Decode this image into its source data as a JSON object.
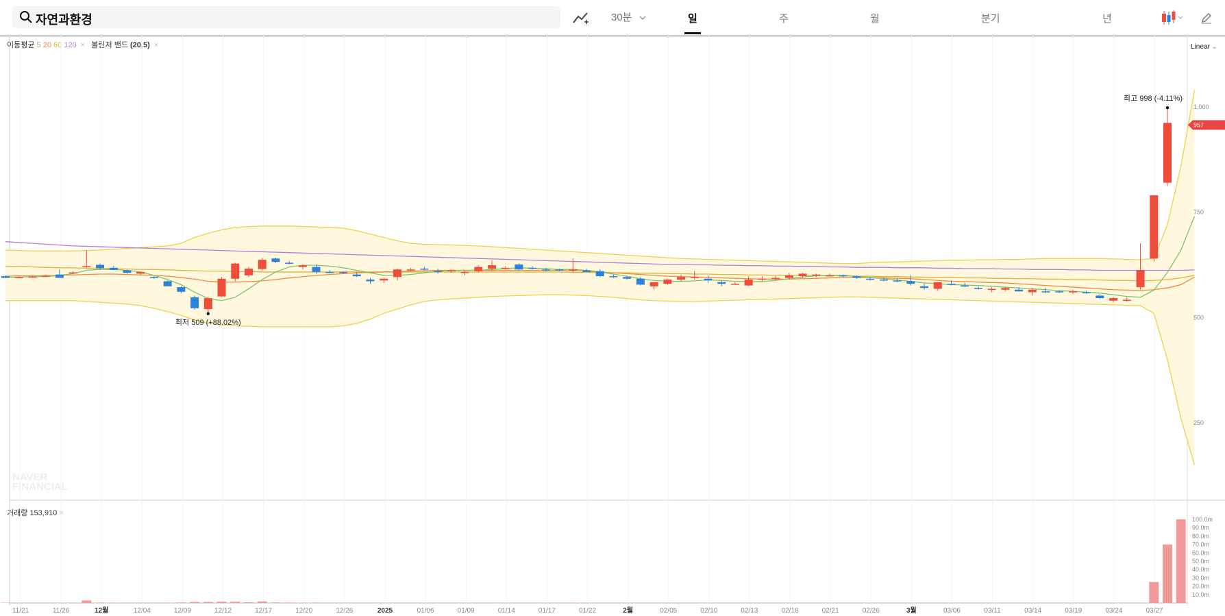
{
  "search": {
    "title": "자연과환경"
  },
  "toolbar": {
    "interval": "30분",
    "tabs": [
      "일",
      "주",
      "월",
      "분기",
      "년"
    ],
    "active_tab": "일"
  },
  "legend": {
    "ma_label": "이동평균",
    "ma_periods": [
      "5",
      "20",
      "60",
      "120"
    ],
    "bb_label": "볼린저 밴드",
    "bb_params": "(20,5)",
    "close_symbol": "×"
  },
  "scale_label": "Linear",
  "volume_label": "거래량",
  "volume_value": "153,910",
  "watermark": [
    "NAVER",
    "FINANCIAL"
  ],
  "colors": {
    "up": "#ee4d3a",
    "down": "#2b82d9",
    "ma5": "#7cc36b",
    "ma20": "#f08a3a",
    "ma60": "#e2b23a",
    "ma120": "#b47fd6",
    "band": "#f0d04e",
    "band_fill": "#fff8de",
    "volume": "#f29a9a"
  },
  "chart_data": {
    "type": "candlestick",
    "price_axis": {
      "ticks": [
        "1,000",
        "750",
        "500",
        "250"
      ],
      "values": [
        1000,
        750,
        500,
        250
      ],
      "current": "957"
    },
    "volume_axis": {
      "ticks": [
        "100.0m",
        "90.0m",
        "80.0m",
        "70.0m",
        "60.0m",
        "50.0m",
        "40.0m",
        "30.0m",
        "20.0m",
        "10.0m"
      ]
    },
    "x_labels": [
      {
        "text": "11/21",
        "bold": false
      },
      {
        "text": "11/26",
        "bold": false
      },
      {
        "text": "12월",
        "bold": true
      },
      {
        "text": "12/04",
        "bold": false
      },
      {
        "text": "12/09",
        "bold": false
      },
      {
        "text": "12/12",
        "bold": false
      },
      {
        "text": "12/17",
        "bold": false
      },
      {
        "text": "12/20",
        "bold": false
      },
      {
        "text": "12/26",
        "bold": false
      },
      {
        "text": "2025",
        "bold": true
      },
      {
        "text": "01/06",
        "bold": false
      },
      {
        "text": "01/09",
        "bold": false
      },
      {
        "text": "01/14",
        "bold": false
      },
      {
        "text": "01/17",
        "bold": false
      },
      {
        "text": "01/22",
        "bold": false
      },
      {
        "text": "2월",
        "bold": true
      },
      {
        "text": "02/05",
        "bold": false
      },
      {
        "text": "02/10",
        "bold": false
      },
      {
        "text": "02/13",
        "bold": false
      },
      {
        "text": "02/18",
        "bold": false
      },
      {
        "text": "02/21",
        "bold": false
      },
      {
        "text": "02/26",
        "bold": false
      },
      {
        "text": "3월",
        "bold": true
      },
      {
        "text": "03/06",
        "bold": false
      },
      {
        "text": "03/11",
        "bold": false
      },
      {
        "text": "03/14",
        "bold": false
      },
      {
        "text": "03/19",
        "bold": false
      },
      {
        "text": "03/24",
        "bold": false
      },
      {
        "text": "03/27",
        "bold": false
      }
    ],
    "annotations": {
      "high": "최고 998 (-4.11%)",
      "low": "최저 509 (+88.02%)"
    },
    "candles": [
      [
        598,
        600,
        595,
        594
      ],
      [
        596,
        598,
        594,
        596
      ],
      [
        596,
        599,
        594,
        597
      ],
      [
        598,
        601,
        597,
        599
      ],
      [
        602,
        614,
        598,
        594
      ],
      [
        605,
        610,
        604,
        607
      ],
      [
        620,
        660,
        618,
        622
      ],
      [
        625,
        628,
        614,
        617
      ],
      [
        618,
        623,
        612,
        613
      ],
      [
        612,
        614,
        604,
        606
      ],
      [
        604,
        608,
        600,
        608
      ],
      [
        596,
        598,
        592,
        594
      ],
      [
        586,
        588,
        576,
        574
      ],
      [
        572,
        575,
        558,
        561
      ],
      [
        548,
        552,
        519,
        522
      ],
      [
        520,
        549,
        509,
        546
      ],
      [
        550,
        596,
        548,
        592
      ],
      [
        592,
        630,
        586,
        628
      ],
      [
        600,
        620,
        596,
        616
      ],
      [
        615,
        642,
        612,
        637
      ],
      [
        640,
        642,
        630,
        632
      ],
      [
        630,
        634,
        626,
        628
      ],
      [
        620,
        626,
        614,
        624
      ],
      [
        620,
        626,
        604,
        608
      ],
      [
        608,
        612,
        605,
        606
      ],
      [
        608,
        610,
        604,
        606
      ],
      [
        602,
        608,
        596,
        598
      ],
      [
        590,
        594,
        580,
        586
      ],
      [
        588,
        594,
        582,
        592
      ],
      [
        596,
        616,
        588,
        614
      ],
      [
        614,
        618,
        610,
        614
      ],
      [
        616,
        620,
        612,
        614
      ],
      [
        610,
        616,
        604,
        608
      ],
      [
        610,
        614,
        606,
        612
      ],
      [
        606,
        612,
        600,
        608
      ],
      [
        610,
        624,
        606,
        620
      ],
      [
        616,
        636,
        612,
        624
      ],
      [
        618,
        622,
        614,
        618
      ],
      [
        626,
        628,
        612,
        614
      ],
      [
        618,
        622,
        614,
        616
      ],
      [
        614,
        618,
        610,
        612
      ],
      [
        614,
        616,
        610,
        612
      ],
      [
        612,
        640,
        608,
        614
      ],
      [
        612,
        616,
        608,
        608
      ],
      [
        610,
        614,
        596,
        598
      ],
      [
        598,
        602,
        594,
        596
      ],
      [
        596,
        598,
        590,
        592
      ],
      [
        592,
        596,
        576,
        578
      ],
      [
        574,
        582,
        566,
        584
      ],
      [
        580,
        592,
        578,
        590
      ],
      [
        590,
        602,
        586,
        596
      ],
      [
        594,
        610,
        590,
        596
      ],
      [
        592,
        600,
        582,
        588
      ],
      [
        584,
        588,
        574,
        580
      ],
      [
        580,
        584,
        578,
        580
      ],
      [
        576,
        598,
        574,
        590
      ],
      [
        590,
        598,
        586,
        592
      ],
      [
        592,
        598,
        588,
        594
      ],
      [
        594,
        606,
        590,
        600
      ],
      [
        598,
        606,
        594,
        604
      ],
      [
        600,
        604,
        596,
        602
      ],
      [
        600,
        604,
        598,
        600
      ],
      [
        600,
        602,
        596,
        598
      ],
      [
        598,
        600,
        592,
        594
      ],
      [
        592,
        596,
        588,
        590
      ],
      [
        590,
        594,
        586,
        588
      ],
      [
        588,
        592,
        584,
        586
      ],
      [
        586,
        600,
        576,
        580
      ],
      [
        574,
        580,
        566,
        570
      ],
      [
        568,
        584,
        564,
        584
      ],
      [
        580,
        588,
        576,
        578
      ],
      [
        576,
        582,
        572,
        574
      ],
      [
        570,
        574,
        566,
        568
      ],
      [
        566,
        572,
        560,
        568
      ],
      [
        566,
        572,
        562,
        570
      ],
      [
        566,
        572,
        562,
        562
      ],
      [
        560,
        570,
        552,
        566
      ],
      [
        562,
        570,
        558,
        560
      ],
      [
        562,
        564,
        558,
        560
      ],
      [
        560,
        566,
        556,
        562
      ],
      [
        560,
        564,
        556,
        558
      ],
      [
        552,
        556,
        544,
        546
      ],
      [
        540,
        548,
        536,
        546
      ],
      [
        542,
        548,
        538,
        542
      ],
      [
        572,
        676,
        566,
        612
      ],
      [
        640,
        790,
        632,
        790
      ],
      [
        820,
        998,
        812,
        962
      ]
    ],
    "ma5": [
      595,
      596,
      597,
      597,
      600,
      604,
      612,
      614,
      614,
      612,
      608,
      600,
      590,
      578,
      560,
      545,
      540,
      548,
      568,
      590,
      608,
      620,
      624,
      624,
      622,
      618,
      612,
      606,
      600,
      600,
      602,
      606,
      610,
      612,
      612,
      612,
      614,
      616,
      618,
      617,
      616,
      614,
      614,
      612,
      608,
      603,
      598,
      592,
      588,
      586,
      586,
      587,
      589,
      588,
      586,
      585,
      585,
      588,
      592,
      596,
      599,
      600,
      600,
      598,
      595,
      592,
      589,
      586,
      582,
      580,
      578,
      577,
      576,
      574,
      572,
      570,
      568,
      566,
      564,
      562,
      560,
      558,
      554,
      550,
      548,
      565,
      607,
      660,
      740
    ],
    "ma20": [
      598,
      599,
      599,
      599,
      600,
      601,
      602,
      603,
      603,
      602,
      601,
      600,
      598,
      595,
      591,
      586,
      584,
      584,
      585,
      587,
      590,
      594,
      597,
      600,
      602,
      604,
      606,
      607,
      608,
      609,
      610,
      611,
      612,
      612,
      612,
      612,
      612,
      612,
      612,
      612,
      612,
      612,
      611,
      610,
      608,
      606,
      604,
      602,
      600,
      598,
      597,
      596,
      595,
      594,
      593,
      592,
      591,
      591,
      591,
      592,
      593,
      594,
      595,
      595,
      595,
      594,
      593,
      592,
      590,
      588,
      586,
      585,
      584,
      583,
      582,
      580,
      578,
      576,
      574,
      572,
      570,
      568,
      566,
      565,
      564,
      566,
      570,
      578,
      596
    ],
    "ma60": [
      622,
      621,
      620,
      619,
      618,
      618,
      617,
      617,
      616,
      615,
      614,
      614,
      613,
      612,
      611,
      610,
      610,
      609,
      609,
      608,
      608,
      608,
      608,
      608,
      608,
      608,
      608,
      608,
      608,
      608,
      608,
      608,
      608,
      608,
      608,
      608,
      608,
      608,
      608,
      608,
      608,
      608,
      607,
      607,
      607,
      606,
      606,
      605,
      605,
      604,
      604,
      603,
      603,
      602,
      602,
      601,
      601,
      600,
      600,
      600,
      599,
      599,
      599,
      598,
      598,
      597,
      597,
      596,
      596,
      595,
      595,
      594,
      594,
      593,
      593,
      592,
      592,
      591,
      591,
      590,
      590,
      589,
      588,
      588,
      587,
      588,
      590,
      594,
      600
    ],
    "ma120": [
      680,
      678,
      676,
      674,
      672,
      670,
      669,
      668,
      667,
      666,
      665,
      664,
      663,
      662,
      661,
      660,
      659,
      658,
      657,
      656,
      655,
      654,
      653,
      652,
      651,
      650,
      649,
      648,
      647,
      646,
      645,
      644,
      643,
      642,
      641,
      640,
      639,
      638,
      637,
      636,
      635,
      634,
      633,
      632,
      631,
      630,
      629,
      628,
      627,
      626,
      626,
      625,
      625,
      624,
      624,
      623,
      623,
      622,
      622,
      621,
      621,
      620,
      620,
      619,
      619,
      619,
      618,
      618,
      618,
      617,
      617,
      616,
      616,
      616,
      615,
      615,
      614,
      614,
      614,
      613,
      613,
      612,
      612,
      612,
      612,
      612,
      612,
      612,
      613
    ],
    "band_upper": [
      660,
      659,
      658,
      658,
      658,
      658,
      659,
      660,
      662,
      664,
      666,
      668,
      670,
      676,
      690,
      700,
      708,
      714,
      716,
      717,
      717,
      717,
      716,
      715,
      714,
      712,
      706,
      698,
      690,
      682,
      676,
      674,
      673,
      672,
      671,
      670,
      668,
      666,
      664,
      662,
      660,
      658,
      656,
      654,
      652,
      650,
      648,
      646,
      644,
      642,
      640,
      639,
      638,
      637,
      636,
      635,
      634,
      633,
      632,
      631,
      630,
      629,
      628,
      628,
      630,
      631,
      632,
      633,
      634,
      635,
      636,
      636,
      637,
      637,
      638,
      638,
      639,
      640,
      640,
      640,
      640,
      640,
      639,
      638,
      637,
      640,
      720,
      860,
      1040
    ],
    "band_lower": [
      540,
      540,
      540,
      540,
      540,
      540,
      538,
      536,
      534,
      532,
      528,
      522,
      514,
      505,
      494,
      486,
      482,
      480,
      479,
      478,
      478,
      478,
      478,
      478,
      478,
      480,
      486,
      496,
      510,
      520,
      530,
      538,
      542,
      544,
      546,
      548,
      550,
      551,
      552,
      553,
      554,
      554,
      553,
      552,
      550,
      548,
      545,
      542,
      540,
      539,
      538,
      538,
      539,
      540,
      541,
      542,
      543,
      544,
      545,
      546,
      547,
      548,
      549,
      549,
      548,
      547,
      546,
      545,
      544,
      543,
      542,
      541,
      540,
      539,
      538,
      537,
      536,
      535,
      534,
      533,
      532,
      531,
      530,
      529,
      528,
      510,
      400,
      260,
      150
    ],
    "volume_m": [
      0.4,
      0.2,
      0.2,
      0.3,
      0.3,
      0.2,
      3.0,
      0.5,
      0.4,
      0.3,
      0.3,
      0.3,
      0.4,
      0.6,
      1.2,
      1.2,
      1.5,
      1.5,
      0.8,
      1.8,
      0.6,
      0.5,
      0.4,
      0.5,
      0.3,
      0.3,
      0.3,
      0.3,
      0.2,
      0.3,
      0.2,
      0.2,
      0.2,
      0.2,
      0.2,
      0.3,
      0.3,
      0.2,
      0.2,
      0.2,
      0.2,
      0.2,
      0.4,
      0.2,
      0.2,
      0.2,
      0.2,
      0.3,
      0.2,
      0.2,
      0.3,
      0.3,
      0.2,
      0.2,
      0.2,
      0.3,
      0.2,
      0.2,
      0.2,
      0.3,
      0.2,
      0.2,
      0.2,
      0.2,
      0.2,
      0.2,
      0.2,
      0.2,
      0.2,
      0.2,
      0.2,
      0.2,
      0.2,
      0.2,
      0.2,
      0.2,
      0.2,
      0.2,
      0.2,
      0.2,
      0.2,
      0.2,
      0.2,
      0.2,
      0.2,
      25.0,
      70.0,
      100.0
    ]
  }
}
